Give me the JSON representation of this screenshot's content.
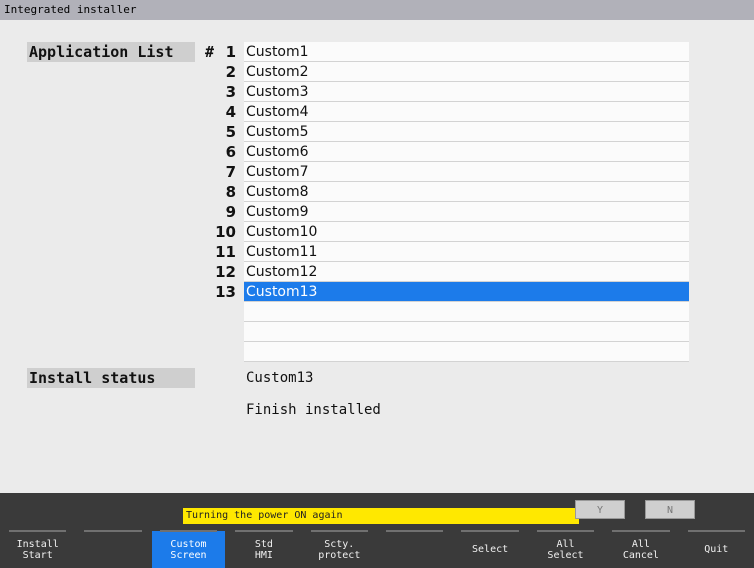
{
  "window": {
    "title": "Integrated installer"
  },
  "application_list": {
    "label": "Application List",
    "hash": "#",
    "items": [
      {
        "num": "1",
        "name": "Custom1"
      },
      {
        "num": "2",
        "name": "Custom2"
      },
      {
        "num": "3",
        "name": "Custom3"
      },
      {
        "num": "4",
        "name": "Custom4"
      },
      {
        "num": "5",
        "name": "Custom5"
      },
      {
        "num": "6",
        "name": "Custom6"
      },
      {
        "num": "7",
        "name": "Custom7"
      },
      {
        "num": "8",
        "name": "Custom8"
      },
      {
        "num": "9",
        "name": "Custom9"
      },
      {
        "num": "10",
        "name": "Custom10"
      },
      {
        "num": "11",
        "name": "Custom11"
      },
      {
        "num": "12",
        "name": "Custom12"
      },
      {
        "num": "13",
        "name": "Custom13"
      },
      {
        "num": "",
        "name": ""
      },
      {
        "num": "",
        "name": ""
      },
      {
        "num": "",
        "name": ""
      }
    ],
    "selected_index": 12
  },
  "install_status": {
    "label": "Install status",
    "current": "Custom13",
    "result": "Finish installed"
  },
  "prompt": {
    "message": "Turning the power ON again",
    "yes": "Y",
    "no": "N"
  },
  "function_keys": [
    {
      "label": "Install\nStart",
      "active": false
    },
    {
      "label": "",
      "active": false
    },
    {
      "label": "Custom\nScreen",
      "active": true
    },
    {
      "label": "Std\nHMI",
      "active": false
    },
    {
      "label": "Scty.\nprotect",
      "active": false
    },
    {
      "label": "",
      "active": false
    },
    {
      "label": "Select",
      "active": false
    },
    {
      "label": "All\nSelect",
      "active": false
    },
    {
      "label": "All\nCancel",
      "active": false
    },
    {
      "label": "Quit",
      "active": false
    }
  ],
  "colors": {
    "selected_row": "#1c7bea",
    "message_bar": "#ffe800",
    "title_bar": "#b1b1b9",
    "bottom_panel": "#3a3a3a"
  }
}
